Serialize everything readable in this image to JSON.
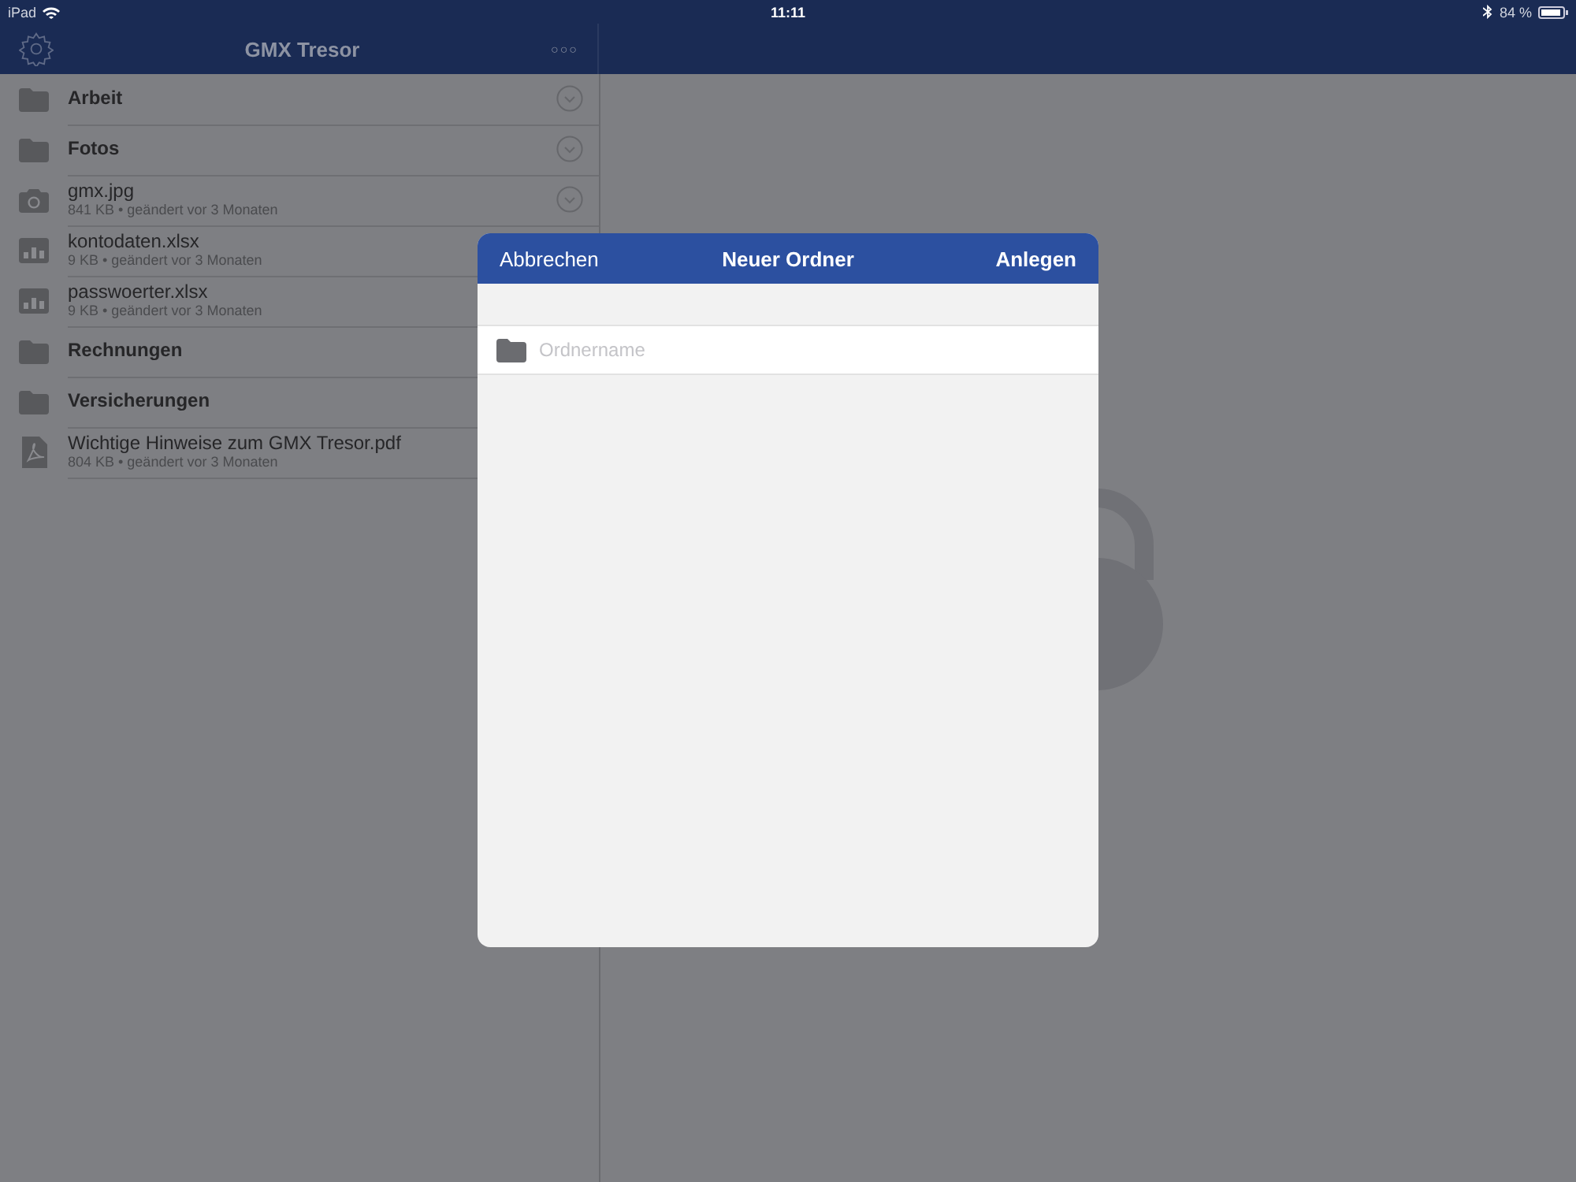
{
  "status_bar": {
    "device": "iPad",
    "time": "11:11",
    "battery": "84 %"
  },
  "nav_bar": {
    "title": "GMX Tresor",
    "more": "○○○"
  },
  "files": [
    {
      "kind": "folder",
      "name": "Arbeit",
      "action": true
    },
    {
      "kind": "folder",
      "name": "Fotos",
      "action": true
    },
    {
      "kind": "image",
      "name": "gmx.jpg",
      "meta": "841 KB • geändert vor 3 Monaten",
      "action": true
    },
    {
      "kind": "sheet",
      "name": "kontodaten.xlsx",
      "meta": "9 KB • geändert vor 3 Monaten",
      "action": false
    },
    {
      "kind": "sheet",
      "name": "passwoerter.xlsx",
      "meta": "9 KB • geändert vor 3 Monaten",
      "action": false
    },
    {
      "kind": "folder",
      "name": "Rechnungen",
      "action": false
    },
    {
      "kind": "folder",
      "name": "Versicherungen",
      "action": false
    },
    {
      "kind": "pdf",
      "name": "Wichtige Hinweise zum GMX Tresor.pdf",
      "meta": "804 KB • geändert vor 3 Monaten",
      "action": false
    }
  ],
  "dialog": {
    "cancel": "Abbrechen",
    "title": "Neuer Ordner",
    "confirm": "Anlegen",
    "field": {
      "placeholder": "Ordnername"
    }
  }
}
